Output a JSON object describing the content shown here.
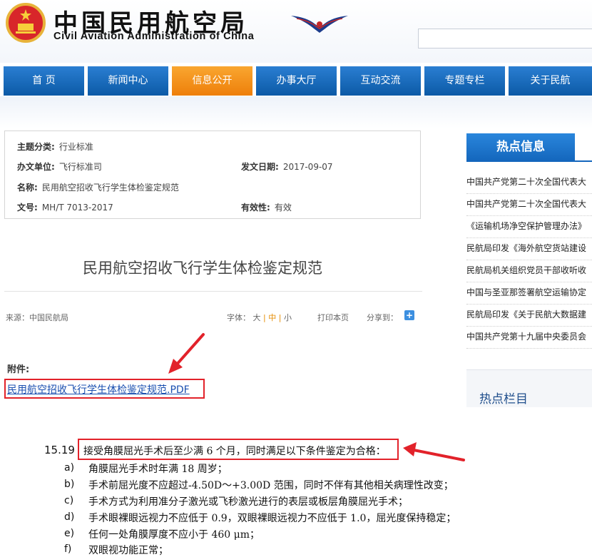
{
  "header": {
    "title_cn": "中国民用航空局",
    "title_en": "Civil Aviation Administration of China",
    "emblem_icon": "national-emblem-icon",
    "logo_icon": "caac-wings-logo-icon",
    "search_placeholder": ""
  },
  "nav": {
    "items": [
      {
        "label": "首 页"
      },
      {
        "label": "新闻中心"
      },
      {
        "label": "信息公开",
        "active": true
      },
      {
        "label": "办事大厅"
      },
      {
        "label": "互动交流"
      },
      {
        "label": "专题专栏"
      },
      {
        "label": "关于民航"
      }
    ]
  },
  "info": {
    "category_label": "主题分类:",
    "category": "行业标准",
    "issuer_label": "办文单位:",
    "issuer": "飞行标准司",
    "date_label": "发文日期:",
    "date": "2017-09-07",
    "name_label": "名称:",
    "name": "民用航空招收飞行学生体检鉴定规范",
    "docno_label": "文号:",
    "docno": "MH/T 7013-2017",
    "validity_label": "有效性:",
    "validity": "有效"
  },
  "article": {
    "title": "民用航空招收飞行学生体检鉴定规范",
    "source": "来源：中国民航局",
    "font_label": "字体：",
    "font_large": "大",
    "font_medium": "中",
    "font_small": "小",
    "sep": "|",
    "print": "打印本页",
    "share": "分享到：",
    "share_icon": "plus-icon",
    "attachment_label": "附件:",
    "attachment_link": "民用航空招收飞行学生体检鉴定规范.PDF"
  },
  "sidebar": {
    "hot_title": "热点信息",
    "hot_items": [
      "中国共产党第二十次全国代表大",
      "中国共产党第二十次全国代表大",
      "《运输机场净空保护管理办法》",
      "民航局印发《海外航空货站建设",
      "民航局机关组织党员干部收听收",
      "中国与圣亚那签署航空运输协定",
      "民航局印发《关于民航大数据建",
      "中国共产党第十九届中央委员会"
    ],
    "column_title": "热点栏目"
  },
  "excerpt": {
    "clause_no": "15.19",
    "clause_head": "接受角膜屈光手术后至少满 6 个月，同时满足以下条件鉴定为合格：",
    "items": [
      {
        "letter": "a)",
        "text": "角膜屈光手术时年满 18 周岁；"
      },
      {
        "letter": "b)",
        "text": "手术前屈光度不应超过-4.50D～+3.00D 范围，同时不伴有其他相关病理性改变；"
      },
      {
        "letter": "c)",
        "text": "手术方式为利用准分子激光或飞秒激光进行的表层或板层角膜屈光手术；"
      },
      {
        "letter": "d)",
        "text": "手术眼裸眼远视力不应低于 0.9，双眼裸眼远视力不应低于 1.0，屈光度保持稳定；"
      },
      {
        "letter": "e)",
        "text": "任何一处角膜厚度不应小于 460  μm；"
      },
      {
        "letter": "f)",
        "text": "双眼视功能正常；"
      }
    ]
  },
  "colors": {
    "nav_blue": "#0c5aa6",
    "nav_active": "#ee7f0a",
    "highlight_red": "#e2222a",
    "link": "#1a4fb0"
  }
}
